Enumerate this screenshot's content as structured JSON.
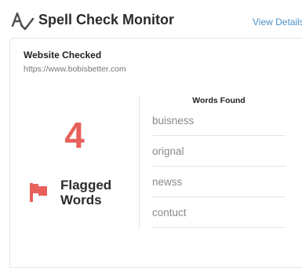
{
  "header": {
    "title": "Spell Check Monitor",
    "view_details": "View Details"
  },
  "site": {
    "label": "Website Checked",
    "url": "https://www.bobisbetter.com"
  },
  "summary": {
    "flagged_count": "4",
    "flagged_label": "Flagged Words"
  },
  "words": {
    "heading": "Words Found",
    "items": [
      "buisness",
      "orignal",
      "newss",
      "contuct"
    ]
  },
  "colors": {
    "accent_red": "#e8605a",
    "link_blue": "#4a90c8"
  }
}
